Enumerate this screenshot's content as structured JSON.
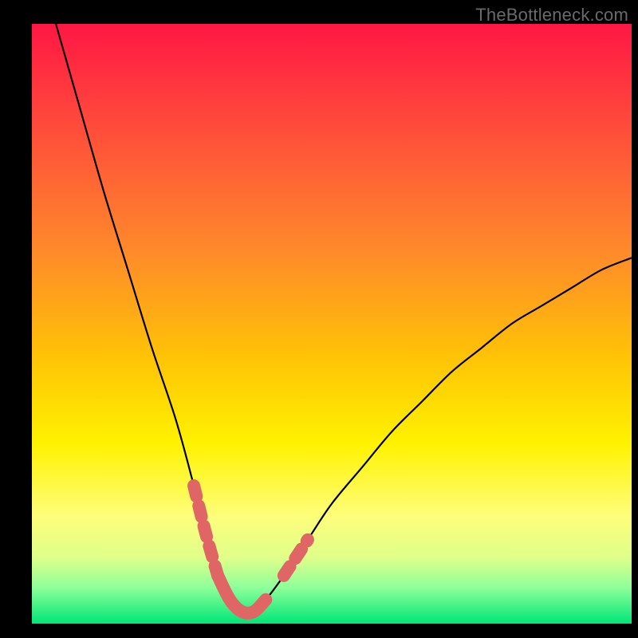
{
  "watermark": "TheBottleneck.com",
  "chart_data": {
    "type": "line",
    "title": "",
    "xlabel": "",
    "ylabel": "",
    "xlim": [
      0,
      100
    ],
    "ylim": [
      0,
      100
    ],
    "series": [
      {
        "name": "curve",
        "x": [
          4,
          8,
          12,
          16,
          20,
          24,
          27,
          29,
          31,
          33,
          35,
          37,
          39,
          42,
          46,
          50,
          55,
          60,
          65,
          70,
          75,
          80,
          85,
          90,
          95,
          100
        ],
        "values": [
          100,
          86,
          72,
          59,
          46,
          34,
          23,
          15,
          8,
          4,
          2,
          2,
          4,
          8,
          14,
          20,
          26,
          32,
          37,
          42,
          46,
          50,
          53,
          56,
          59,
          61
        ]
      },
      {
        "name": "highlight-left",
        "x": [
          27,
          29,
          31
        ],
        "values": [
          23,
          15,
          8
        ]
      },
      {
        "name": "highlight-bottom",
        "x": [
          31,
          33,
          35,
          37,
          39
        ],
        "values": [
          8,
          4,
          2,
          2,
          4
        ]
      },
      {
        "name": "highlight-right",
        "x": [
          42,
          44,
          46
        ],
        "values": [
          8,
          11,
          14
        ]
      }
    ],
    "gradient_stops": [
      {
        "offset": 0,
        "color": "#ff1744"
      },
      {
        "offset": 18,
        "color": "#ff4e3a"
      },
      {
        "offset": 38,
        "color": "#ff8a2a"
      },
      {
        "offset": 55,
        "color": "#ffc107"
      },
      {
        "offset": 70,
        "color": "#fff200"
      },
      {
        "offset": 82,
        "color": "#fefe7a"
      },
      {
        "offset": 89,
        "color": "#dfff8a"
      },
      {
        "offset": 94,
        "color": "#8dff9a"
      },
      {
        "offset": 100,
        "color": "#00e676"
      }
    ]
  }
}
